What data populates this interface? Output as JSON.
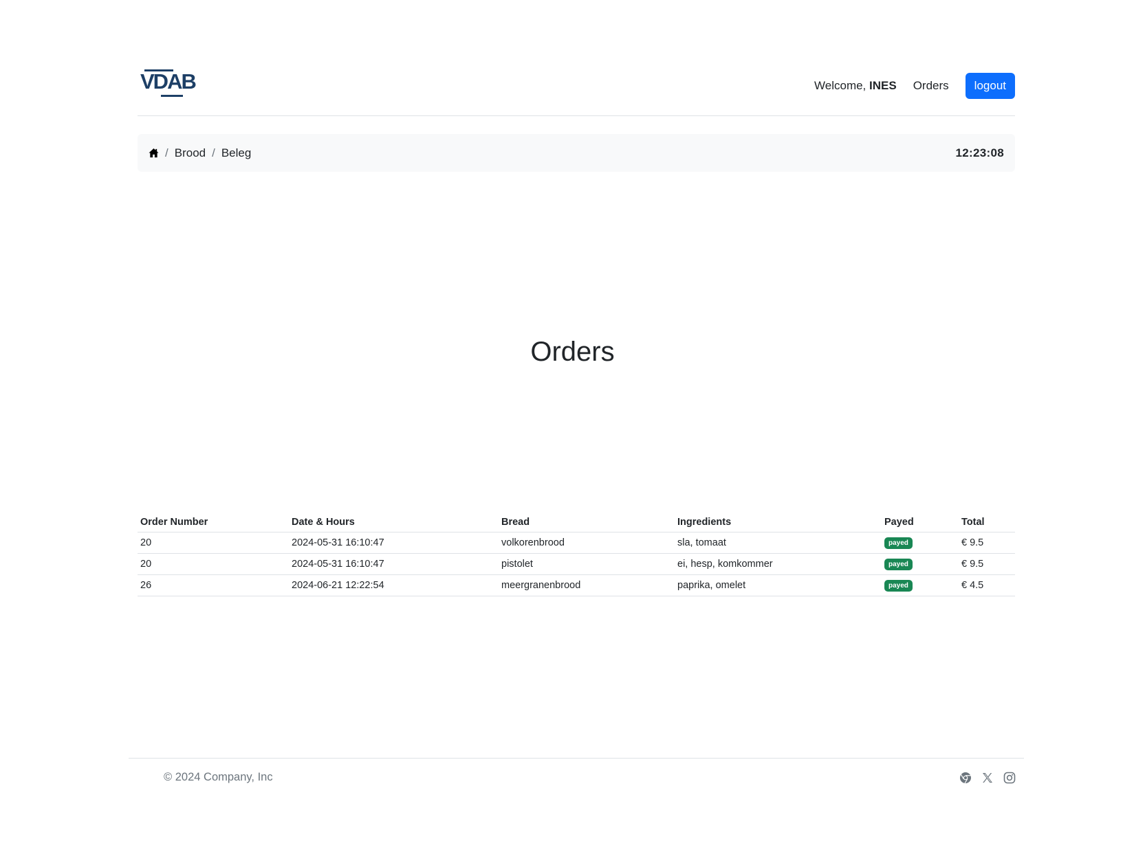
{
  "header": {
    "logo_text": "VDAB",
    "welcome_prefix": "Welcome,",
    "username": "INES",
    "nav_orders": "Orders",
    "logout_label": "logout"
  },
  "breadcrumb": {
    "home_icon": "home-icon",
    "items": [
      "Brood",
      "Beleg"
    ],
    "separator": "/",
    "clock": "12:23:08"
  },
  "main": {
    "title": "Orders"
  },
  "table": {
    "columns": [
      "Order Number",
      "Date & Hours",
      "Bread",
      "Ingredients",
      "Payed",
      "Total"
    ],
    "rows": [
      {
        "order": "20",
        "date": "2024-05-31 16:10:47",
        "bread": "volkorenbrood",
        "ingredients": "sla, tomaat",
        "payed": "payed",
        "total": "€ 9.5"
      },
      {
        "order": "20",
        "date": "2024-05-31 16:10:47",
        "bread": "pistolet",
        "ingredients": "ei, hesp, komkommer",
        "payed": "payed",
        "total": "€ 9.5"
      },
      {
        "order": "26",
        "date": "2024-06-21 12:22:54",
        "bread": "meergranenbrood",
        "ingredients": "paprika, omelet",
        "payed": "payed",
        "total": "€ 4.5"
      }
    ]
  },
  "footer": {
    "copyright": "© 2024 Company, Inc",
    "social_icons": [
      "chrome-icon",
      "x-icon",
      "instagram-icon"
    ]
  },
  "colors": {
    "primary": "#0d6efd",
    "success": "#198754",
    "logo": "#1d3f66",
    "breadcrumb_bg": "#f8f9fa"
  }
}
